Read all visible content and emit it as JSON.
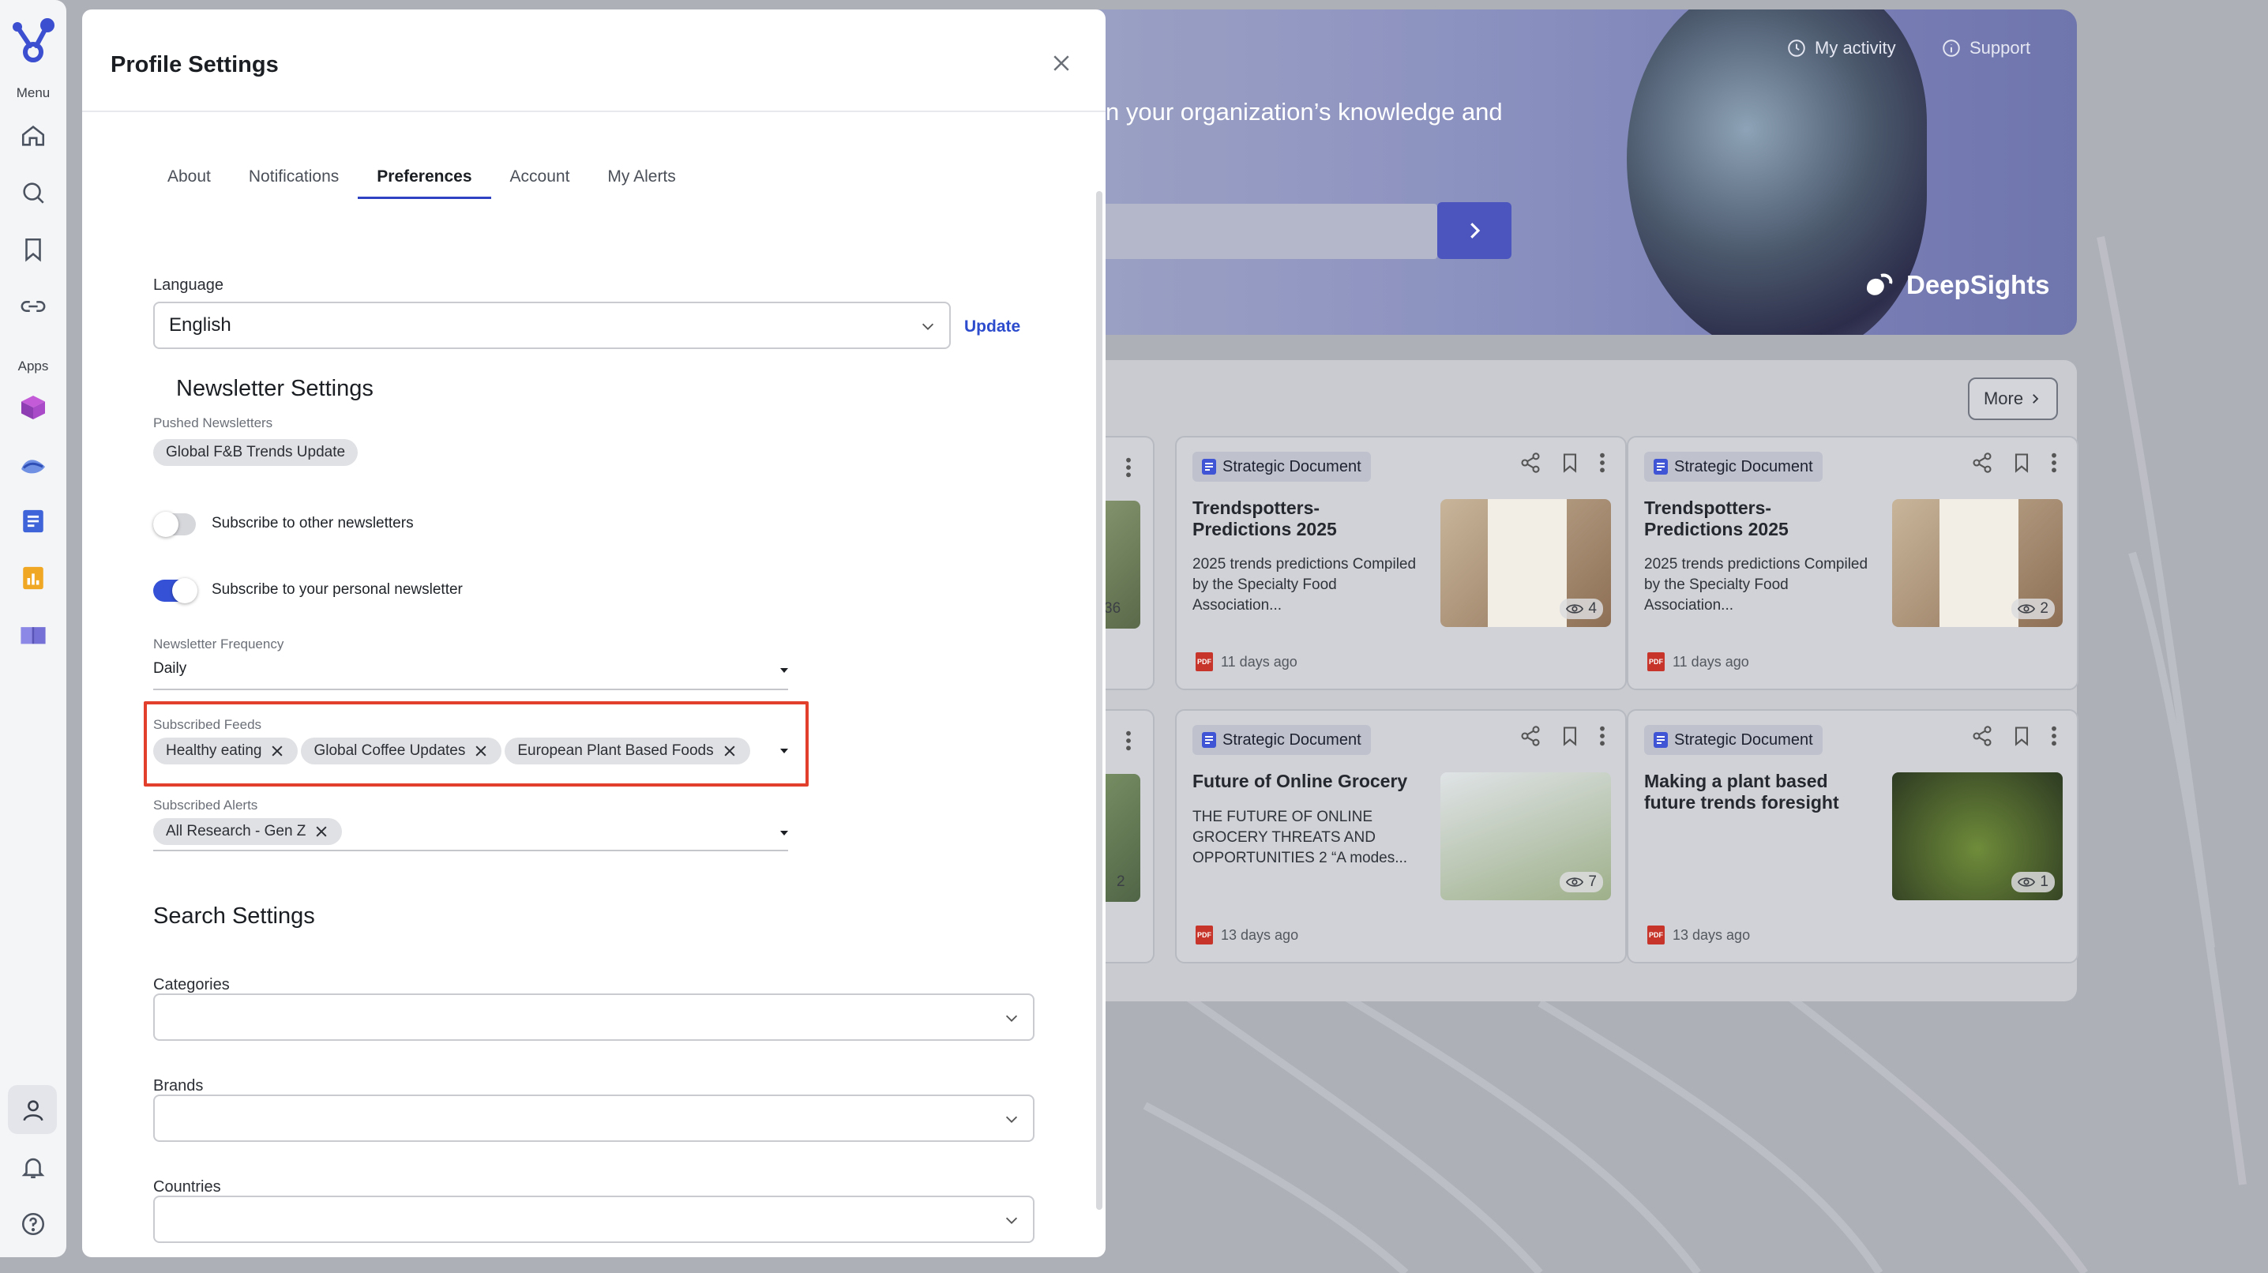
{
  "rail": {
    "menu_label": "Menu",
    "apps_label": "Apps",
    "menu_icons": [
      "home-icon",
      "search-icon",
      "bookmark-icon",
      "link-icon"
    ],
    "app_icons": [
      "cube-app-icon",
      "wave-app-icon",
      "document-app-icon",
      "chart-app-icon",
      "book-app-icon"
    ],
    "bottom_icons": [
      "user-icon",
      "bell-icon",
      "help-icon"
    ]
  },
  "hero": {
    "my_activity": "My activity",
    "support": "Support",
    "headline": "n your organization’s knowledge and",
    "brand": "DeepSights"
  },
  "panel": {
    "more_label": "More",
    "cards": [
      {
        "badge": "Strategic Document",
        "title": "Trendspotters-Predictions 2025",
        "desc": "2025 trends predictions Compiled by the Specialty Food Association...",
        "views": "4",
        "time": "11 days ago"
      },
      {
        "badge": "Strategic Document",
        "title": "Trendspotters-Predictions 2025",
        "desc": "2025 trends predictions Compiled by the Specialty Food Association...",
        "views": "2",
        "time": "11 days ago"
      },
      {
        "badge": "Strategic Document",
        "title": "Future of Online Grocery",
        "desc": "THE FUTURE OF ONLINE GROCERY THREATS AND OPPORTUNITIES 2 “A modes...",
        "views": "7",
        "time": "13 days ago"
      },
      {
        "badge": "Strategic Document",
        "title": "Making a plant based future trends foresight",
        "desc": "",
        "views": "1",
        "time": "13 days ago"
      }
    ],
    "stub_views": [
      "36",
      "2"
    ],
    "pdf_label": "PDF"
  },
  "modal": {
    "title": "Profile Settings",
    "tabs": [
      "About",
      "Notifications",
      "Preferences",
      "Account",
      "My Alerts"
    ],
    "active_tab": "Preferences",
    "language_label": "Language",
    "language_value": "English",
    "update_label": "Update",
    "newsletter_heading": "Newsletter Settings",
    "pushed_label": "Pushed Newsletters",
    "pushed_chip": "Global F&B Trends Update",
    "toggle_other_label": "Subscribe to other newsletters",
    "toggle_other_on": false,
    "toggle_personal_label": "Subscribe to your personal newsletter",
    "toggle_personal_on": true,
    "frequency_label": "Newsletter Frequency",
    "frequency_value": "Daily",
    "feeds_label": "Subscribed Feeds",
    "feeds": [
      "Healthy eating",
      "Global Coffee Updates",
      "European Plant Based Foods"
    ],
    "alerts_label": "Subscribed Alerts",
    "alerts": [
      "All Research - Gen Z"
    ],
    "search_heading": "Search Settings",
    "categories_label": "Categories",
    "brands_label": "Brands",
    "countries_label": "Countries"
  },
  "colors": {
    "accent": "#3042c4",
    "link": "#2c4ccd",
    "toggle_on": "#3552d6",
    "highlight": "#e2402c"
  }
}
